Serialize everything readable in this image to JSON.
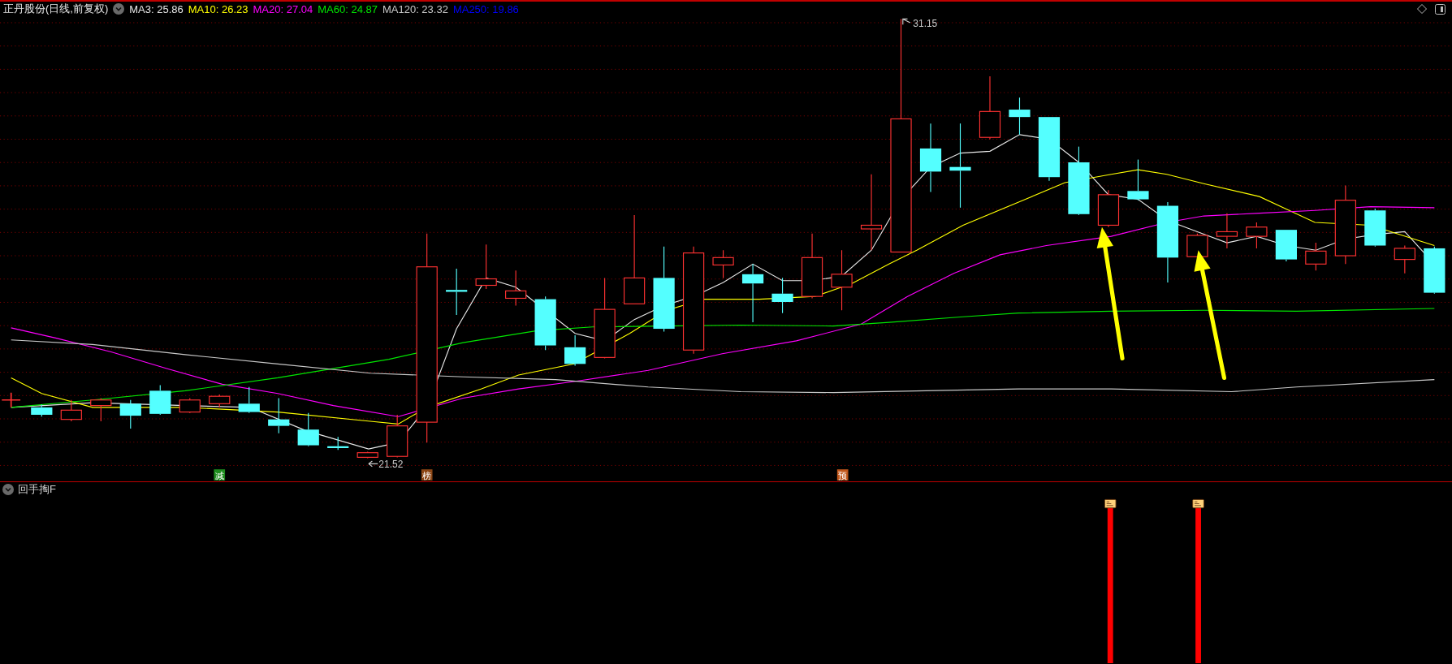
{
  "header": {
    "title": "正丹股份(日线,前复权)"
  },
  "ma_legend": [
    {
      "label": "MA3: 25.86",
      "color": "#e6e6e6"
    },
    {
      "label": "MA10: 26.23",
      "color": "#ffff00"
    },
    {
      "label": "MA20: 27.04",
      "color": "#ff00ff"
    },
    {
      "label": "MA60: 24.87",
      "color": "#00e600"
    },
    {
      "label": "MA120: 23.32",
      "color": "#c8c8c8"
    },
    {
      "label": "MA250: 19.86",
      "color": "#0000ff"
    }
  ],
  "chart": {
    "high_label": "31.15",
    "low_label": "21.52",
    "signals": [
      {
        "text": "减",
        "color": "#1e8c1e"
      },
      {
        "text": "榜",
        "color": "#8c4614"
      },
      {
        "text": "预",
        "color": "#c0561a"
      }
    ]
  },
  "indicator": {
    "name": "回手掏F"
  }
}
